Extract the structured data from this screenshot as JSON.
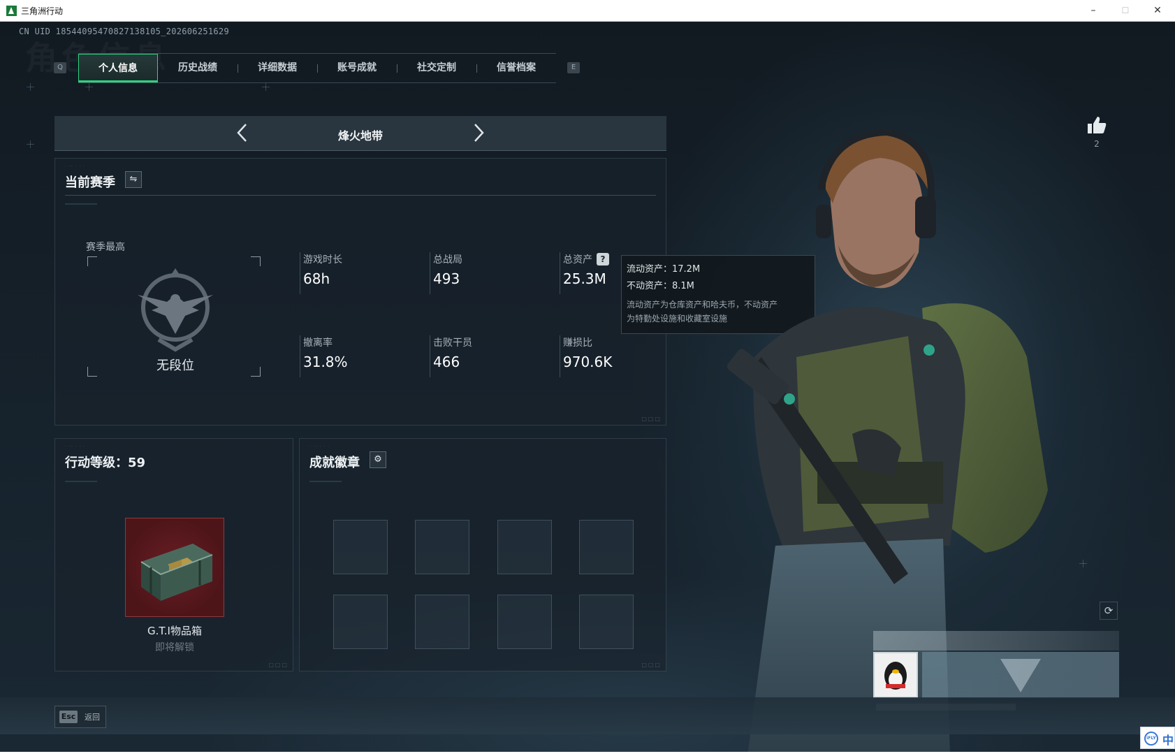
{
  "window": {
    "title": "三角洲行动",
    "minimize": "–",
    "maximize": "☐",
    "close": "✕"
  },
  "background_watermark": "角色信息",
  "uid": "CN UID 18544095470827138105_202606251629",
  "tabs": {
    "left_key": "Q",
    "right_key": "E",
    "items": [
      {
        "label": "个人信息",
        "active": true
      },
      {
        "label": "历史战绩",
        "active": false
      },
      {
        "label": "详细数据",
        "active": false
      },
      {
        "label": "账号成就",
        "active": false
      },
      {
        "label": "社交定制",
        "active": false
      },
      {
        "label": "信誉档案",
        "active": false
      }
    ]
  },
  "mode_selector": {
    "label": "烽火地带",
    "prev_icon": "chevron-left-icon",
    "next_icon": "chevron-right-icon"
  },
  "season_panel": {
    "title": "当前赛季",
    "switch_icon": "swap-icon",
    "best_label": "赛季最高",
    "rank_icon": "eagle-emblem-icon",
    "rank_label": "无段位",
    "stats": [
      {
        "label": "游戏时长",
        "value": "68h"
      },
      {
        "label": "总战局",
        "value": "493"
      },
      {
        "label": "总资产",
        "value": "25.3M",
        "help_icon": "?"
      },
      {
        "label": "撤离率",
        "value": "31.8%"
      },
      {
        "label": "击败干员",
        "value": "466"
      },
      {
        "label": "赚损比",
        "value": "970.6K"
      }
    ]
  },
  "tooltip": {
    "liquid": "流动资产：17.2M",
    "fixed": "不动资产：8.1M",
    "desc_line1": "流动资产为仓库资产和哈夫币，不动资产",
    "desc_line2": "为特勤处设施和收藏室设施"
  },
  "level_panel": {
    "title": "行动等级：59",
    "reward": {
      "icon": "crate-icon",
      "name": "G.T.I物品箱",
      "status": "即将解锁"
    }
  },
  "badges_panel": {
    "title": "成就徽章",
    "settings_icon": "gear-icon",
    "slots": 8
  },
  "likes": {
    "icon": "thumbs-up-icon",
    "count": "2"
  },
  "refresh_icon": "refresh-icon",
  "bottom": {
    "esc_key": "Esc",
    "esc_label": "返回"
  },
  "ime": {
    "icon_text": "iFLY",
    "mode": "中"
  },
  "colors": {
    "accent_green": "#2fd37f",
    "reward_bg": "#5a181d",
    "panel_bg": "#18222c"
  }
}
